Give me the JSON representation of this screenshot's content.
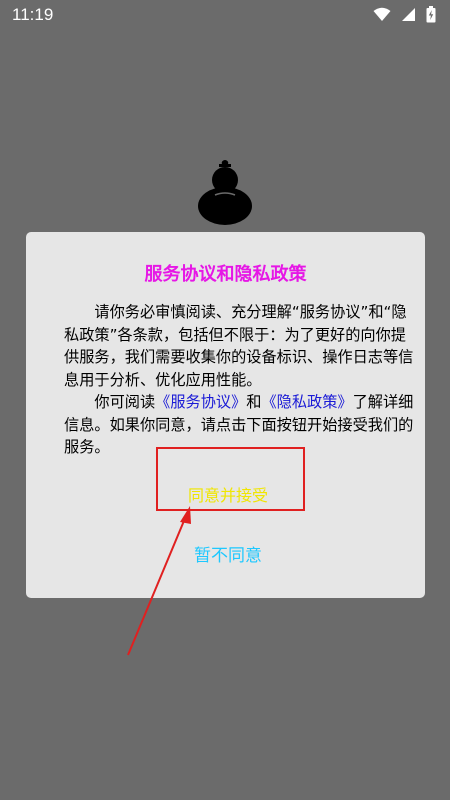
{
  "status_bar": {
    "time": "11:19",
    "icons": [
      "wifi-icon",
      "signal-icon",
      "battery-charging-icon"
    ]
  },
  "app_logo": "gourd-icon",
  "dialog": {
    "title": "服务协议和隐私政策",
    "paragraph1": "请你务必审慎阅读、充分理解“服务协议”和“隐私政策”各条款，包括但不限于：为了更好的向你提供服务，我们需要收集你的设备标识、操作日志等信息用于分析、优化应用性能。",
    "paragraph2_prefix": "你可阅读",
    "service_link": "《服务协议》",
    "paragraph2_and": "和",
    "privacy_link": "《隐私政策》",
    "paragraph2_suffix": "了解详细信息。如果你同意，请点击下面按钮开始接受我们的服务。",
    "accept_label": "同意并接受",
    "decline_label": "暂不同意"
  },
  "colors": {
    "overlay": "#6b6b6b",
    "dialog_bg": "#e6e6e6",
    "title": "#e617e6",
    "link": "#1a1ad6",
    "accept": "#f0e600",
    "decline": "#1ec8ff",
    "annotation": "#e02020"
  }
}
